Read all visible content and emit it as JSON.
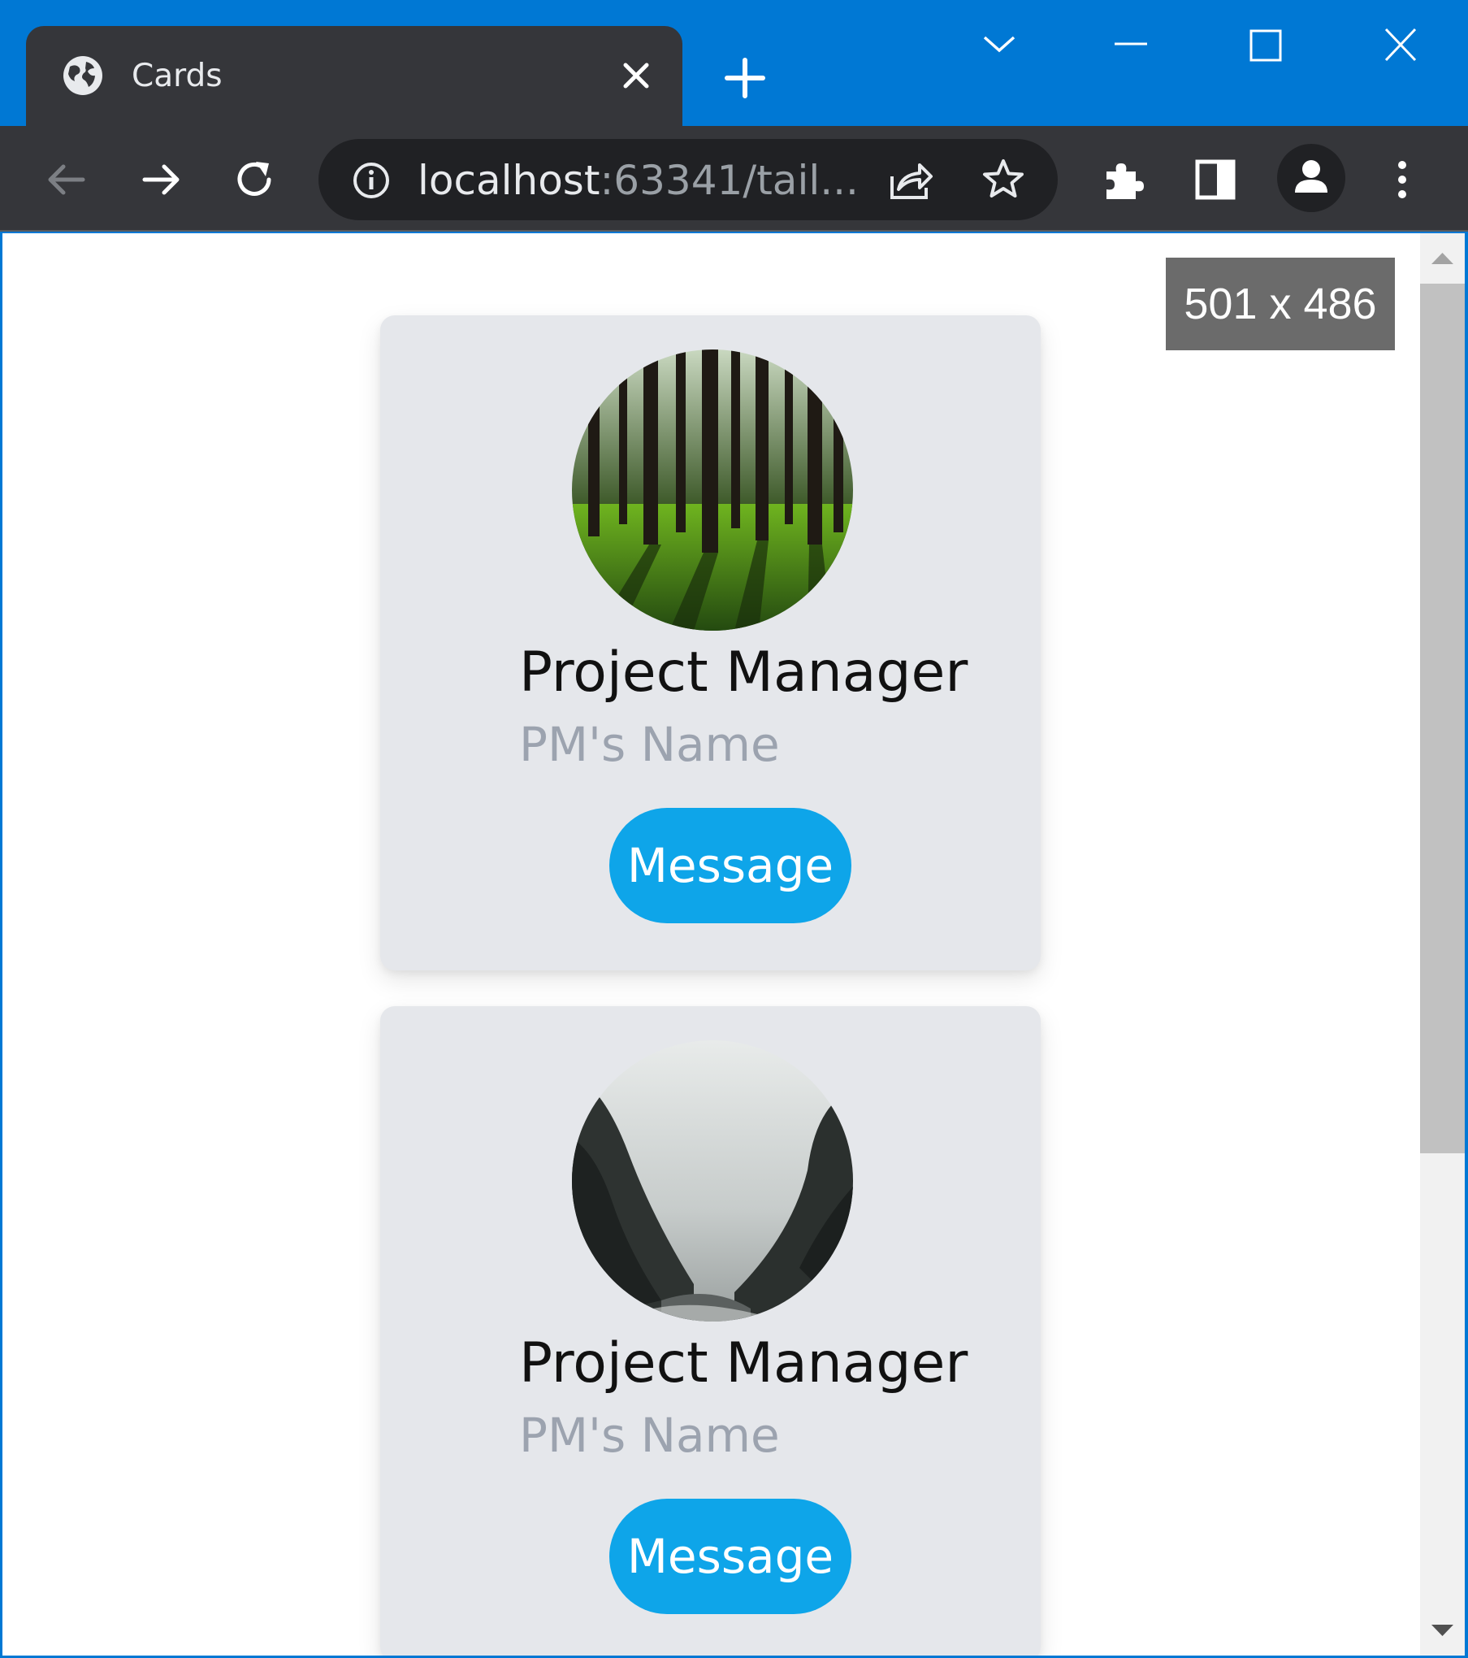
{
  "browser": {
    "tab_title": "Cards",
    "url_host": "localhost",
    "url_rest": ":63341/tail...",
    "icons": {
      "tab_favicon": "globe-icon",
      "tab_close": "close-icon",
      "new_tab": "plus-icon",
      "tab_search": "chevron-down-icon",
      "minimize": "minimize-icon",
      "maximize": "maximize-icon",
      "close_window": "close-icon",
      "back": "arrow-left-icon",
      "forward": "arrow-right-icon",
      "reload": "reload-icon",
      "site_info": "info-icon",
      "share": "share-icon",
      "bookmark": "star-icon",
      "extensions": "puzzle-icon",
      "side_panel": "side-panel-icon",
      "profile": "person-icon",
      "menu": "kebab-menu-icon"
    },
    "colors": {
      "frame": "#0078d4",
      "toolbar": "#35363a",
      "omnibox": "#202124"
    }
  },
  "viewport": {
    "size_badge": "501 x 486"
  },
  "cards": [
    {
      "image": "forest",
      "role": "Project Manager",
      "name": "PM's Name",
      "button_label": "Message"
    },
    {
      "image": "misty-canyon",
      "role": "Project Manager",
      "name": "PM's Name",
      "button_label": "Message"
    }
  ],
  "colors": {
    "card_bg": "#e5e7eb",
    "button_bg": "#0ea5e9",
    "name_text": "#9ca3af"
  }
}
